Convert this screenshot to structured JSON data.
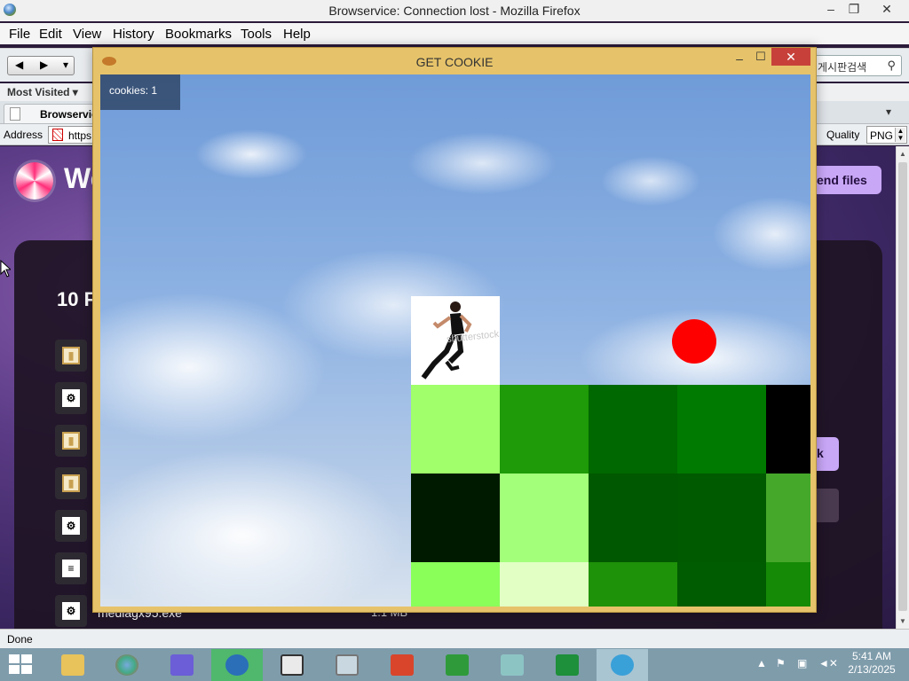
{
  "firefox": {
    "title": "Browservice: Connection lost - Mozilla Firefox",
    "min": "–",
    "max": "❐",
    "close": "✕"
  },
  "menu": [
    "File",
    "Edit",
    "View",
    "History",
    "Bookmarks",
    "Tools",
    "Help"
  ],
  "menu_underlines": [
    "F",
    "E",
    "V",
    "s",
    "B",
    "T",
    "H"
  ],
  "nav": {
    "back": "◀",
    "forward": "▶",
    "dropdown": "▾"
  },
  "search": {
    "text": "게시판검색",
    "icon": "search-icon"
  },
  "bookmarks": {
    "most_visited": "Most Visited ▾"
  },
  "tab": {
    "label": "Browservic",
    "list_icon": "▾"
  },
  "address": {
    "label": "Address",
    "url": "https",
    "quality_label": "Quality",
    "quality_value": "PNG"
  },
  "page": {
    "welcome": "We",
    "send_files": "end files",
    "panel_title": "10 F",
    "side_button": "k",
    "file_name": "mediagx95.exe",
    "file_size": "1.1 MB",
    "file_icons": [
      "image-file-icon",
      "settings-file-icon",
      "image-file-icon",
      "image-file-icon",
      "settings-file-icon",
      "text-file-icon",
      "settings-file-icon"
    ]
  },
  "status": "Done",
  "popup": {
    "title": "GET COOKIE",
    "min": "–",
    "max": "☐",
    "close": "✕",
    "cookies_label": "cookies: 1",
    "watermark": "shutterstock"
  },
  "game": {
    "tiles": [
      [
        "#a0ff6a",
        "#1f9a08",
        "#006800",
        "#007a00",
        "#000000"
      ],
      [
        "#001a00",
        "#a3ff7a",
        "#005800",
        "#005a00",
        "#46a82a"
      ],
      [
        "#8aff5a",
        "#e2ffc4",
        "#1e9208",
        "#005c00",
        "#158a06"
      ]
    ],
    "ball_color": "#ff0000"
  },
  "taskbar": {
    "apps": [
      "file-explorer-icon",
      "browser-icon",
      "bird-app-icon",
      "monster-app-icon",
      "network-app-icon",
      "photos-app-icon",
      "music-app-icon",
      "store-app-icon",
      "notebook-app-icon",
      "games-app-icon",
      "heart-app-icon"
    ],
    "time": "5:41 AM",
    "date": "2/13/2025"
  }
}
